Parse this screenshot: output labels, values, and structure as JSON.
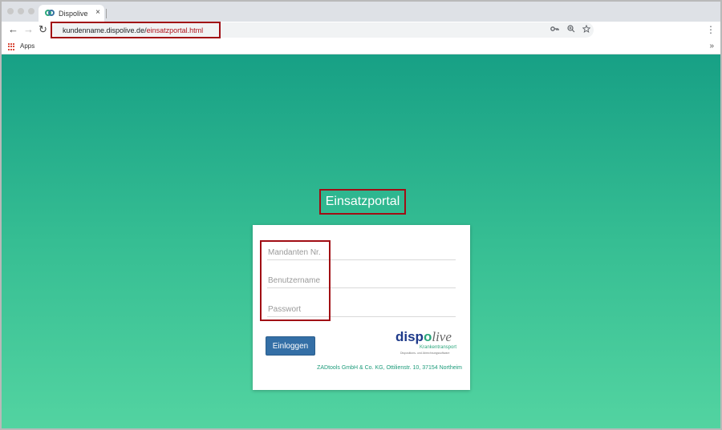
{
  "browser": {
    "tab_title": "Dispolive",
    "tab_close": "×",
    "url_host": "kundenname.dispolive.de/",
    "url_path": "einsatzportal.html",
    "bookmarks": {
      "apps_label": "Apps",
      "more": "»"
    },
    "nav": {
      "back": "←",
      "forward": "→",
      "reload": "↻"
    },
    "omnibox_icons": [
      "key-icon",
      "zoom-icon",
      "star-icon"
    ],
    "menu": "⋮"
  },
  "page": {
    "title": "Einsatzportal",
    "form": {
      "fields": [
        {
          "placeholder": "Mandanten Nr.",
          "value": ""
        },
        {
          "placeholder": "Benutzername",
          "value": ""
        },
        {
          "placeholder": "Passwort",
          "value": ""
        }
      ],
      "login_label": "Einloggen"
    },
    "logo": {
      "brand_first": "disp",
      "brand_o": "o",
      "brand_second": "live",
      "sub": "Krankentransport",
      "tagline": "Dispositions- und Abrechnungssoftware"
    },
    "footer": "ZADtools GmbH & Co. KG, Ottilienstr. 10, 37154 Northeim"
  },
  "colors": {
    "accent_red": "#a10d14",
    "gradient_top": "#17a085",
    "gradient_bottom": "#53d4a1",
    "button_blue": "#346fa6",
    "logo_navy": "#1e3a8a",
    "logo_green": "#2aa57b"
  }
}
